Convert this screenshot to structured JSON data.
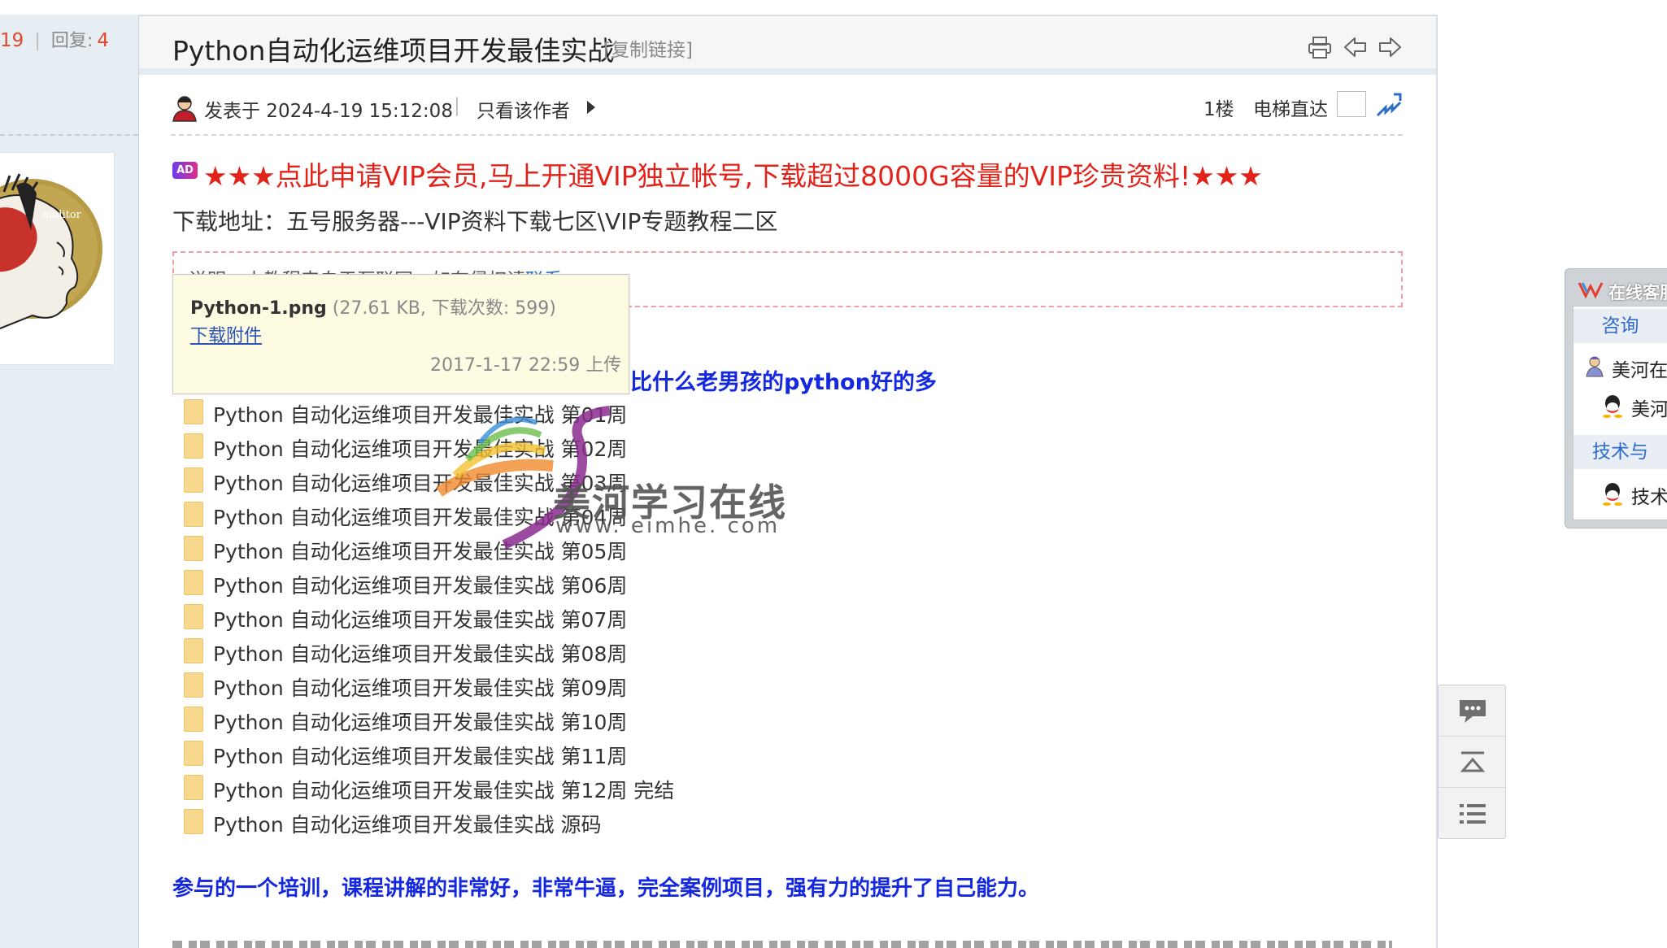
{
  "thread": {
    "views": "19",
    "replies_label": "回复:",
    "replies": "4",
    "title": "Python自动化运维项目开发最佳实战",
    "copy_link": "[复制链接]"
  },
  "post": {
    "posted_at": "发表于 2024-4-19 15:12:08",
    "separator": "|",
    "only_author": "只看该作者",
    "floor": "1楼",
    "elevator": "电梯直达",
    "ad_badge": "AD",
    "ad_text": "★★★点此申请VIP会员,马上开通VIP独立帐号,下载超过8000G容量的VIP珍贵资料!★★★",
    "download_address": "下载地址：五号服务器---VIP资料下载七区\\VIP专题教程二区",
    "notice_text": "说明：本教程来自于互联网，如有侵权请",
    "notice_link": "联系",
    "blue_heading": "比什么老男孩的python好的多",
    "folders": [
      "Python 自动化运维项目开发最佳实战 第01周",
      "Python 自动化运维项目开发最佳实战 第02周",
      "Python 自动化运维项目开发最佳实战 第03周",
      "Python 自动化运维项目开发最佳实战 第04周",
      "Python 自动化运维项目开发最佳实战 第05周",
      "Python 自动化运维项目开发最佳实战 第06周",
      "Python 自动化运维项目开发最佳实战 第07周",
      "Python 自动化运维项目开发最佳实战 第08周",
      "Python 自动化运维项目开发最佳实战 第09周",
      "Python 自动化运维项目开发最佳实战 第10周",
      "Python 自动化运维项目开发最佳实战 第11周",
      "Python 自动化运维项目开发最佳实战 第12周 完结",
      "Python 自动化运维项目开发最佳实战 源码"
    ],
    "watermark_cn": "美河学习在线",
    "watermark_url": "www. eimhe. com",
    "bottom_text": "参与的一个培训，课程讲解的非常好，非常牛逼，完全案例项目，强有力的提升了自己能力。"
  },
  "tooltip": {
    "filename": "Python-1.png",
    "meta": " (27.61 KB, 下载次数: 599)",
    "download": "下载附件",
    "uploaded": "2017-1-17 22:59 上传"
  },
  "online_service": {
    "title": "在线客服",
    "section_consult": "咨询",
    "consult_item_1": "美河在",
    "consult_item_2": "美河",
    "section_tech": "技术与",
    "tech_item": "技术"
  },
  "icons": {
    "print": "printer-icon",
    "prev": "prev-thread-icon",
    "next": "next-thread-icon",
    "reply": "reply-icon",
    "top": "back-to-top-icon",
    "list": "list-icon",
    "elevator_go": "jump-icon",
    "folder": "folder-icon",
    "qq": "qq-icon"
  },
  "colors": {
    "accent_red": "#e2231a",
    "link_blue": "#1428e0",
    "stat_red": "#e2482b",
    "tooltip_bg": "#fefbe3"
  }
}
